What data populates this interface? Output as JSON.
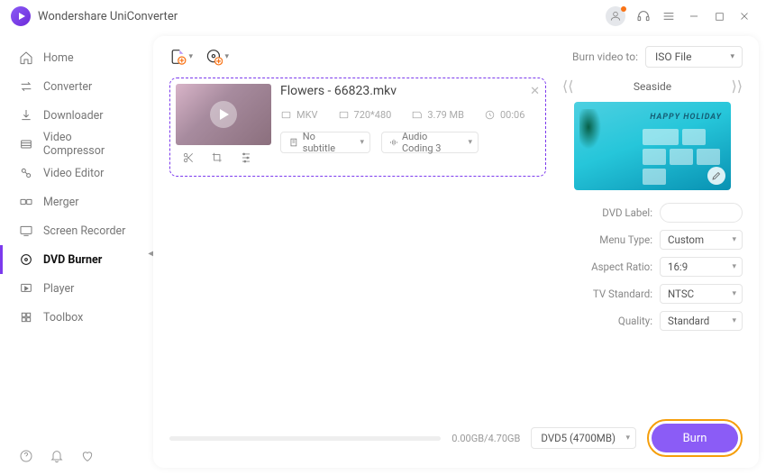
{
  "app": {
    "title": "Wondershare UniConverter"
  },
  "sidebar": {
    "items": [
      {
        "label": "Home"
      },
      {
        "label": "Converter"
      },
      {
        "label": "Downloader"
      },
      {
        "label": "Video Compressor"
      },
      {
        "label": "Video Editor"
      },
      {
        "label": "Merger"
      },
      {
        "label": "Screen Recorder"
      },
      {
        "label": "DVD Burner"
      },
      {
        "label": "Player"
      },
      {
        "label": "Toolbox"
      }
    ]
  },
  "header": {
    "burn_to_label": "Burn video to:",
    "burn_target": "ISO File"
  },
  "file": {
    "title": "Flowers - 66823.mkv",
    "format": "MKV",
    "resolution": "720*480",
    "size": "3.79 MB",
    "duration": "00:06",
    "subtitle_value": "No subtitle",
    "audio_value": "Audio Coding 3"
  },
  "template": {
    "name": "Seaside",
    "preview_title": "HAPPY HOLIDAY"
  },
  "form": {
    "dvd_label_label": "DVD Label:",
    "dvd_label_value": "",
    "menu_type_label": "Menu Type:",
    "menu_type_value": "Custom",
    "aspect_label": "Aspect Ratio:",
    "aspect_value": "16:9",
    "tv_label": "TV Standard:",
    "tv_value": "NTSC",
    "quality_label": "Quality:",
    "quality_value": "Standard"
  },
  "bottom": {
    "size_text": "0.00GB/4.70GB",
    "disc_type": "DVD5 (4700MB)",
    "burn_label": "Burn"
  }
}
